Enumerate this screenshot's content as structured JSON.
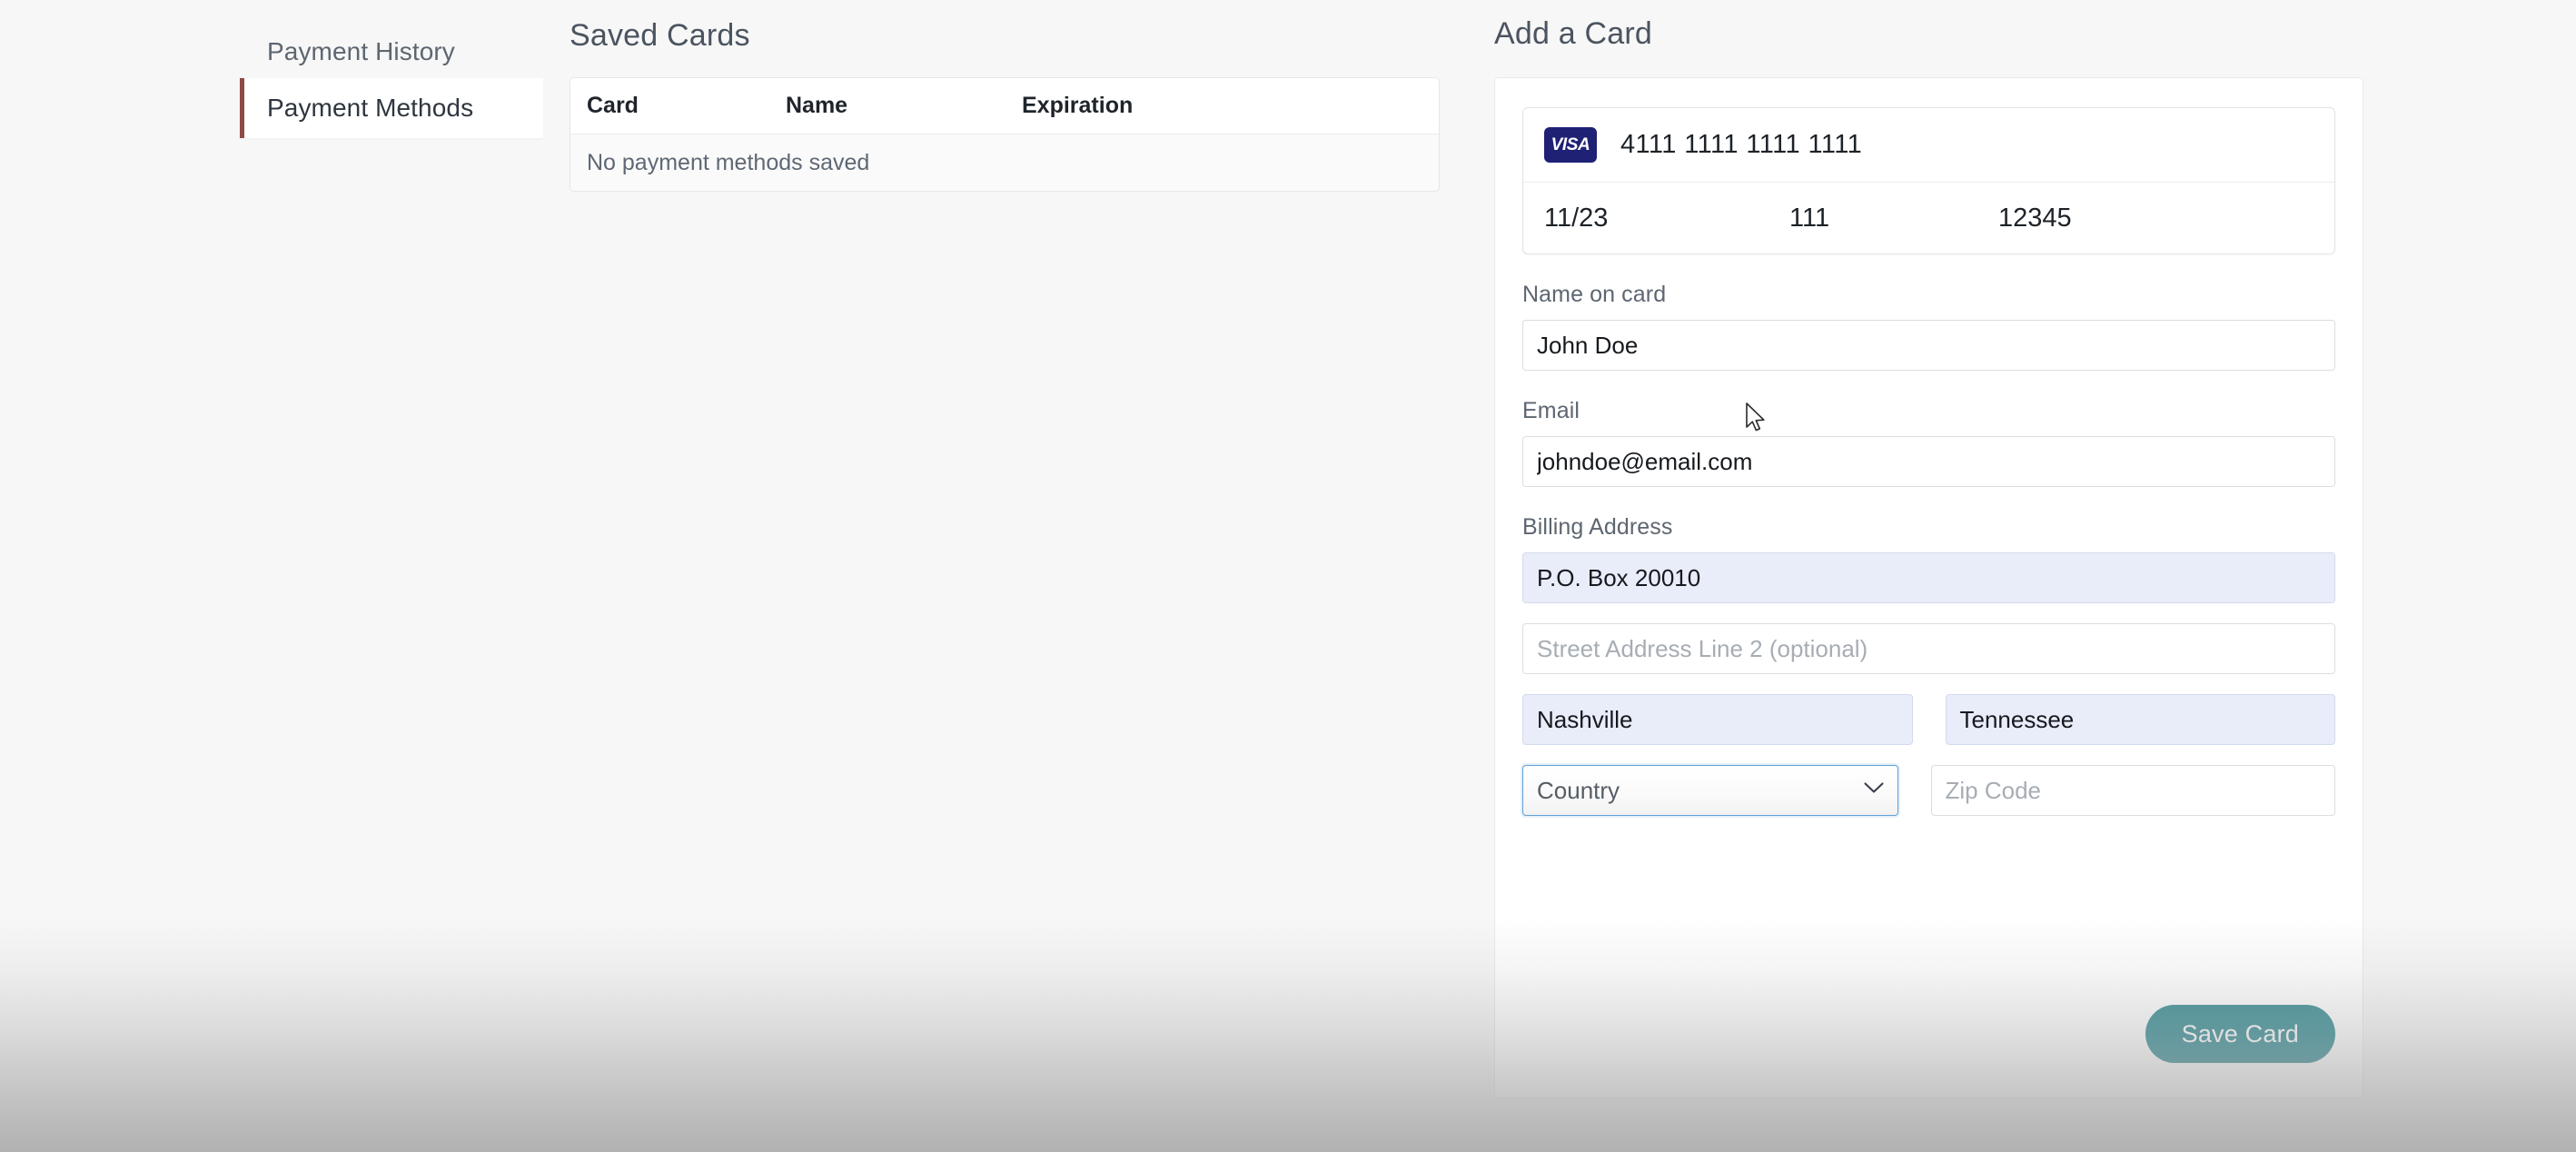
{
  "sidebar": {
    "items": [
      {
        "label": "Payment History",
        "active": false
      },
      {
        "label": "Payment Methods",
        "active": true
      }
    ]
  },
  "saved_cards": {
    "title": "Saved Cards",
    "columns": [
      "Card",
      "Name",
      "Expiration"
    ],
    "empty_message": "No payment methods saved",
    "rows": []
  },
  "add_card": {
    "title": "Add a Card",
    "card_entry": {
      "brand_icon": "visa-icon",
      "brand_label": "VISA",
      "number": "4111 1111 1111 1111",
      "expiry": "11/23",
      "cvc": "111",
      "postal": "12345"
    },
    "fields": {
      "name_label": "Name on card",
      "name_value": "John Doe",
      "email_label": "Email",
      "email_value": "johndoe@email.com",
      "billing_label": "Billing Address",
      "address1_value": "P.O. Box 20010",
      "address2_placeholder": "Street Address Line 2 (optional)",
      "address2_value": "",
      "city_value": "Nashville",
      "state_value": "Tennessee",
      "country_placeholder": "Country",
      "country_options": [
        "Country"
      ],
      "zip_placeholder": "Zip Code",
      "zip_value": ""
    },
    "save_label": "Save Card"
  },
  "colors": {
    "page_background": "#f7f7f7",
    "active_accent": "#8e4a46",
    "visa_blue": "#1f2175",
    "save_button": "#3d9198",
    "autofill_background": "#e9edfa",
    "focus_border": "#60a0d6",
    "label_text": "#5d6671"
  }
}
